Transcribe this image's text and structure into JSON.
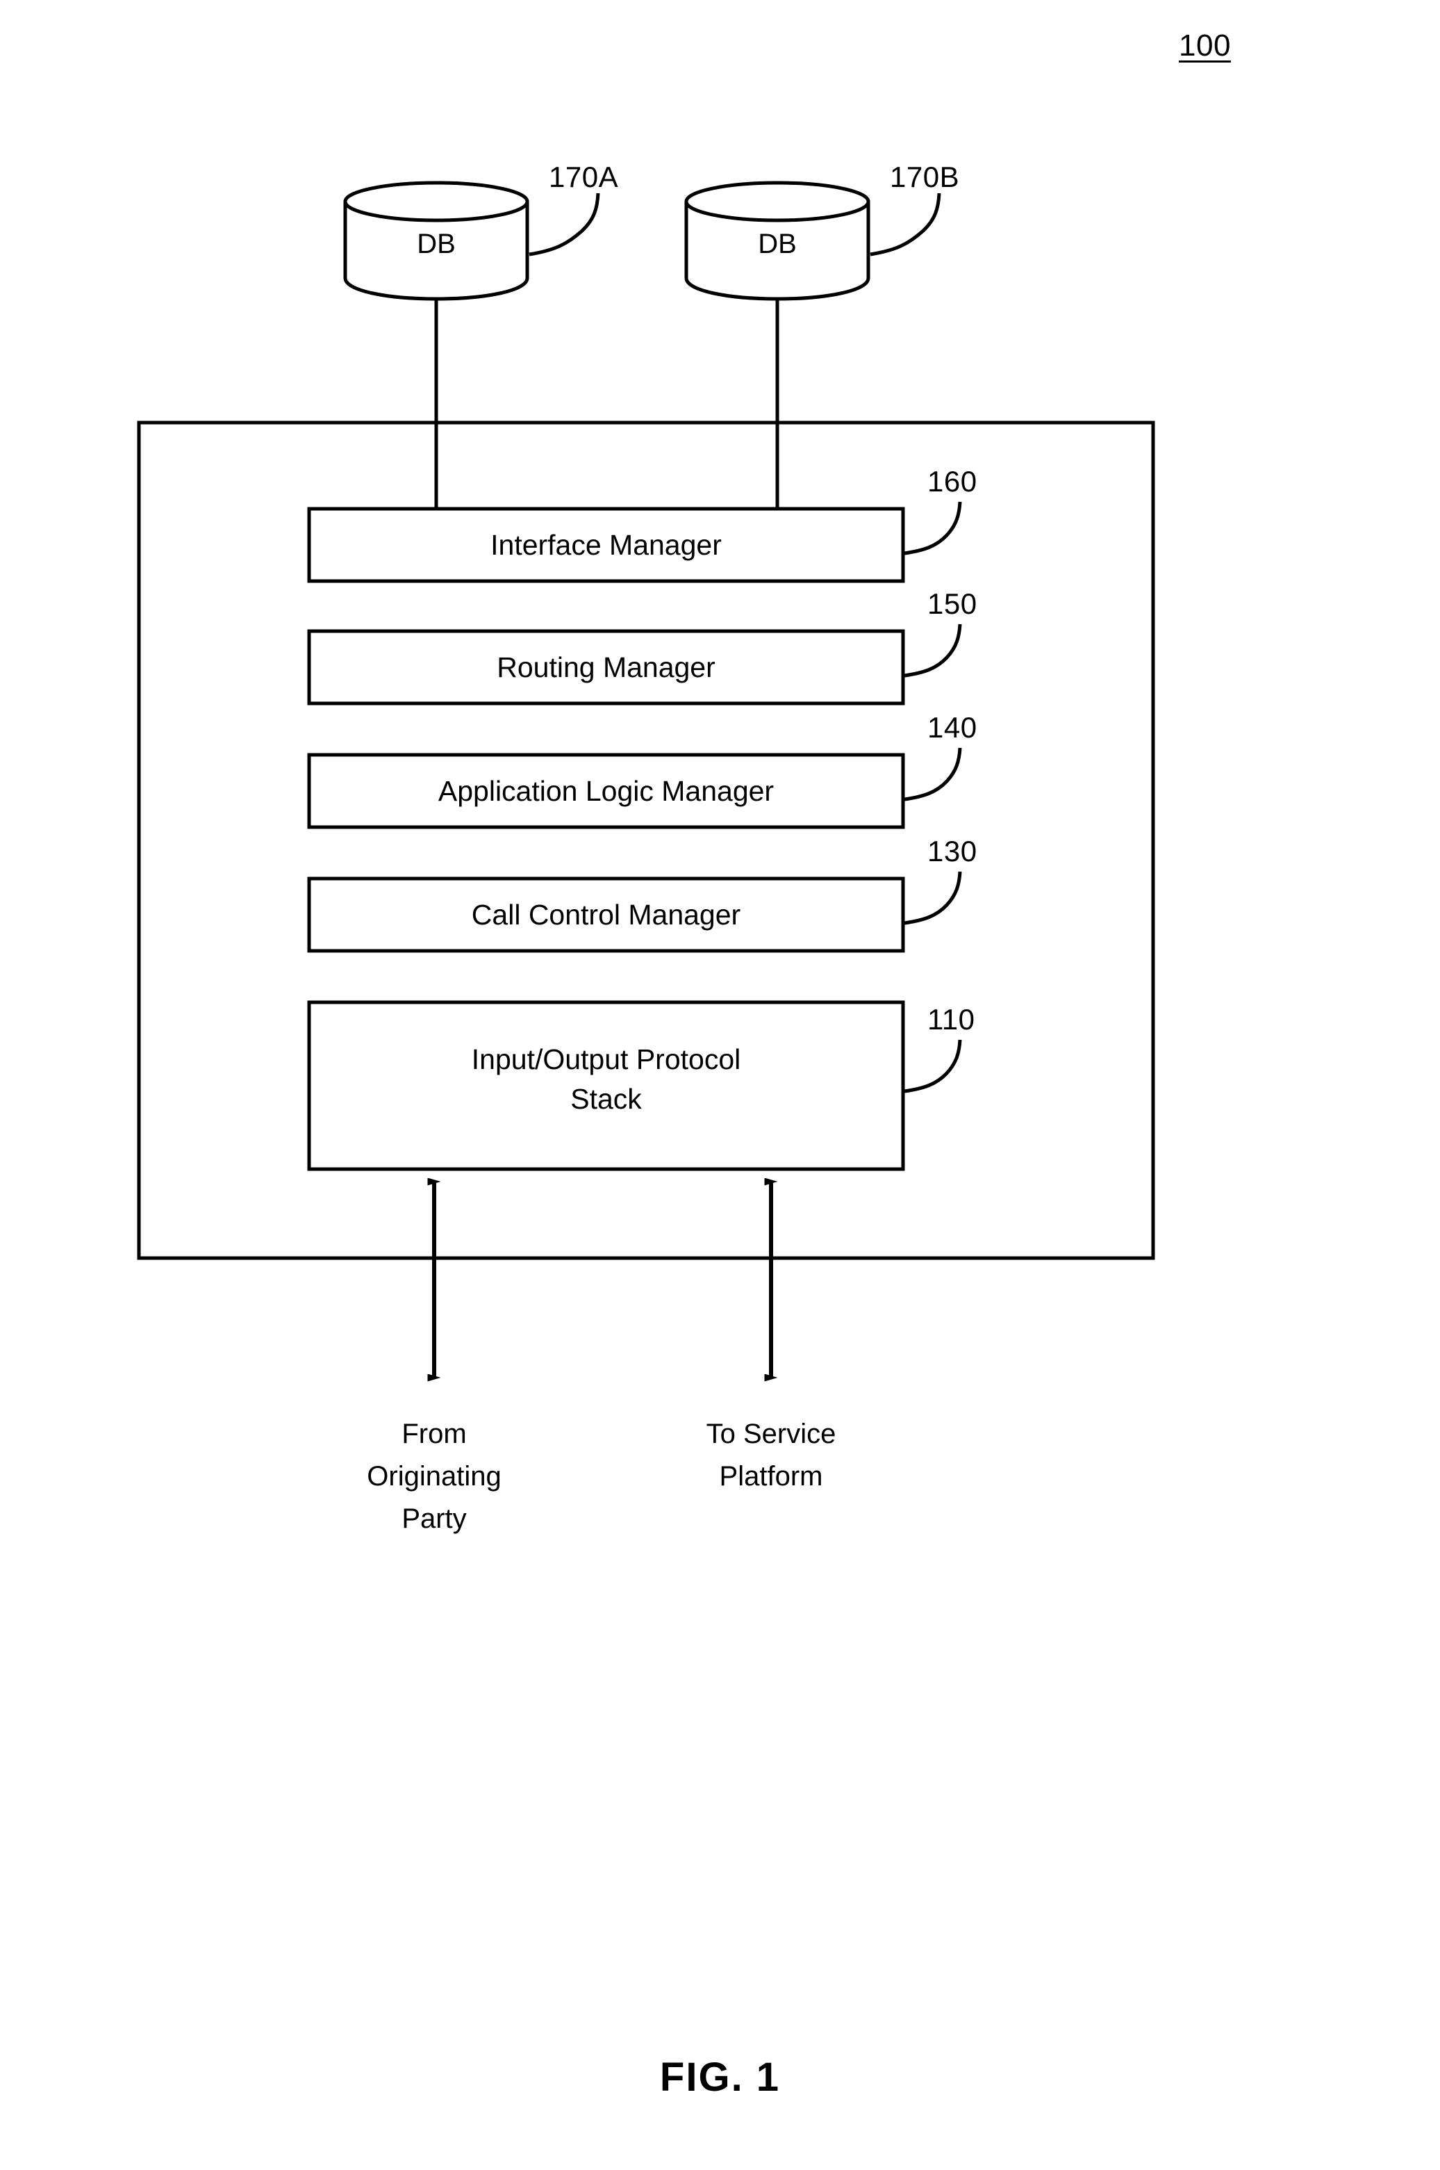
{
  "figure": {
    "number_label": "100",
    "caption": "FIG. 1"
  },
  "databases": [
    {
      "label": "DB",
      "ref": "170A"
    },
    {
      "label": "DB",
      "ref": "170B"
    }
  ],
  "system_blocks": [
    {
      "label": "Interface Manager",
      "ref": "160"
    },
    {
      "label": "Routing Manager",
      "ref": "150"
    },
    {
      "label": "Application Logic Manager",
      "ref": "140"
    },
    {
      "label": "Call Control Manager",
      "ref": "130"
    },
    {
      "label_line1": "Input/Output Protocol",
      "label_line2": "Stack",
      "ref": "110"
    }
  ],
  "endpoints": [
    {
      "line1": "From",
      "line2": "Originating",
      "line3": "Party"
    },
    {
      "line1": "To Service",
      "line2": "Platform",
      "line3": ""
    }
  ],
  "colors": {
    "stroke": "#000000",
    "background": "#ffffff"
  }
}
